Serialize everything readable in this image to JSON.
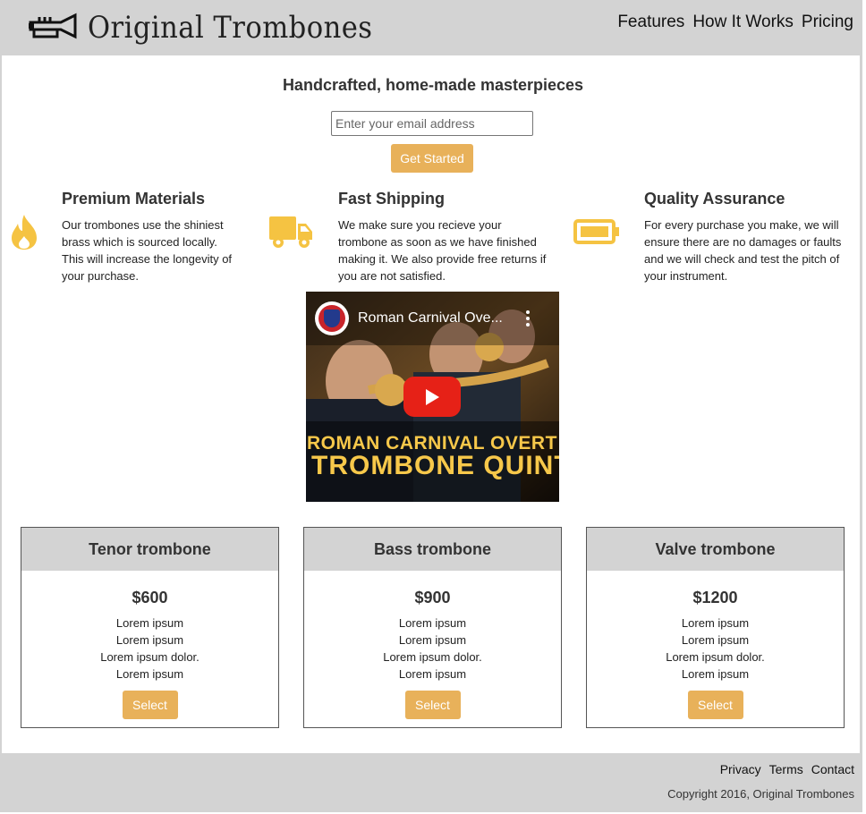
{
  "header": {
    "brand": "Original Trombones",
    "nav": [
      "Features",
      "How It Works",
      "Pricing"
    ]
  },
  "hero": {
    "title": "Handcrafted, home-made masterpieces",
    "email_placeholder": "Enter your email address",
    "cta_label": "Get Started"
  },
  "features": [
    {
      "icon": "fire-icon",
      "title": "Premium Materials",
      "lines": [
        "Our trombones use the shiniest",
        "brass which is sourced locally.",
        "This will increase the longevity of",
        "your purchase."
      ]
    },
    {
      "icon": "truck-icon",
      "title": "Fast Shipping",
      "lines": [
        "We make sure you recieve your",
        "trombone as soon as we have finished",
        "making it. We also provide free returns if",
        "you are not satisfied."
      ]
    },
    {
      "icon": "battery-icon",
      "title": "Quality Assurance",
      "lines": [
        "For every purchase you make, we will",
        "ensure there are no damages or faults",
        "and we will check and test the pitch of",
        "your instrument."
      ]
    }
  ],
  "video": {
    "title": "Roman Carnival Ove...",
    "overlay_line1": "ROMAN CARNIVAL OVERT",
    "overlay_line2": "TROMBONE QUINT"
  },
  "pricing": [
    {
      "name": "Tenor trombone",
      "price": "$600",
      "items": [
        "Lorem ipsum",
        "Lorem ipsum",
        "Lorem ipsum dolor.",
        "Lorem ipsum"
      ],
      "button": "Select"
    },
    {
      "name": "Bass trombone",
      "price": "$900",
      "items": [
        "Lorem ipsum",
        "Lorem ipsum",
        "Lorem ipsum dolor.",
        "Lorem ipsum"
      ],
      "button": "Select"
    },
    {
      "name": "Valve trombone",
      "price": "$1200",
      "items": [
        "Lorem ipsum",
        "Lorem ipsum",
        "Lorem ipsum dolor.",
        "Lorem ipsum"
      ],
      "button": "Select"
    }
  ],
  "footer": {
    "links": [
      "Privacy",
      "Terms",
      "Contact"
    ],
    "copyright": "Copyright 2016, Original Trombones"
  },
  "colors": {
    "accent": "#e8b15a",
    "icon": "#f5c342",
    "bar": "#d3d3d3"
  }
}
